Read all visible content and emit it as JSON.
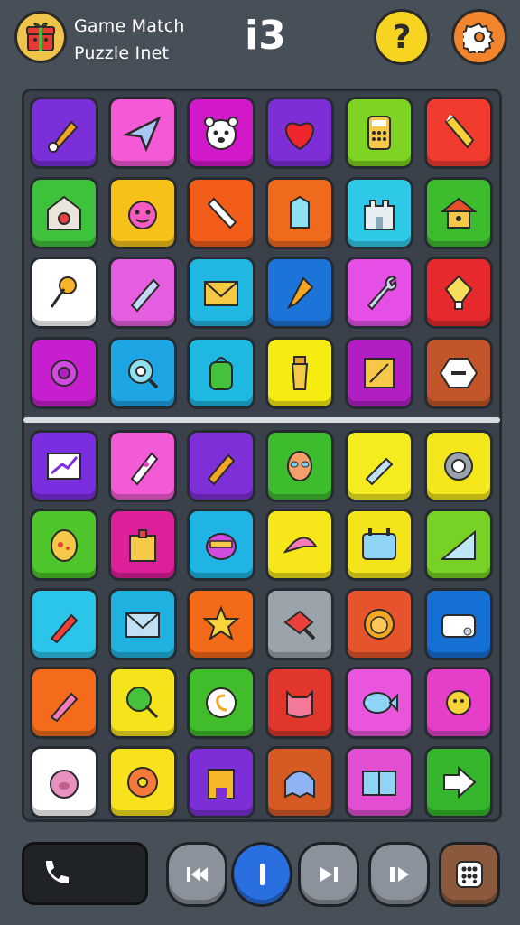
{
  "header": {
    "title_line1": "Game Match",
    "title_line2": "Puzzle Inet",
    "score": "i3",
    "help_label": "?",
    "icons": {
      "app": "gift-box-icon",
      "help": "question-icon",
      "settings": "gear-icon"
    }
  },
  "board": {
    "rows": [
      [
        {
          "color": "#7a2fd9",
          "icon": "paintbrush"
        },
        {
          "color": "#f45ad6",
          "icon": "paper-plane"
        },
        {
          "color": "#d219c9",
          "icon": "bear-face"
        },
        {
          "color": "#7d2ed6",
          "icon": "heart"
        },
        {
          "color": "#7fd322",
          "icon": "calculator"
        },
        {
          "color": "#f23b2f",
          "icon": "pencil"
        }
      ],
      [
        {
          "color": "#3fc23b",
          "icon": "house-camera"
        },
        {
          "color": "#f6c21a",
          "icon": "pink-monster"
        },
        {
          "color": "#f25e1a",
          "icon": "marker"
        },
        {
          "color": "#f06a1e",
          "icon": "crystal"
        },
        {
          "color": "#2fc9e8",
          "icon": "castle"
        },
        {
          "color": "#3dbd2e",
          "icon": "birdhouse"
        }
      ],
      [
        {
          "color": "#ffffff",
          "icon": "pushpin"
        },
        {
          "color": "#e65ee0",
          "icon": "crayon"
        },
        {
          "color": "#21b7e3",
          "icon": "envelope"
        },
        {
          "color": "#1c73d8",
          "icon": "dropper"
        },
        {
          "color": "#e54fe6",
          "icon": "wrench"
        },
        {
          "color": "#e6292c",
          "icon": "lightbulb"
        }
      ],
      [
        {
          "color": "#c71fd0",
          "icon": "gear"
        },
        {
          "color": "#1ea5e3",
          "icon": "magnifier"
        },
        {
          "color": "#1fb8e0",
          "icon": "backpack"
        },
        {
          "color": "#f7ec12",
          "icon": "cup"
        },
        {
          "color": "#b11ec2",
          "icon": "map"
        },
        {
          "color": "#c2562a",
          "icon": "hexagon"
        }
      ]
    ],
    "rows_lower": [
      [
        {
          "color": "#7b2ee0",
          "icon": "chart"
        },
        {
          "color": "#f25ad6",
          "icon": "rocket"
        },
        {
          "color": "#7e2fd8",
          "icon": "pencil-orange"
        },
        {
          "color": "#3dbc2d",
          "icon": "alien"
        },
        {
          "color": "#f4ec1e",
          "icon": "syringe"
        },
        {
          "color": "#f3e61b",
          "icon": "robot-gear"
        }
      ],
      [
        {
          "color": "#4ec52a",
          "icon": "egg"
        },
        {
          "color": "#de1f9a",
          "icon": "bag"
        },
        {
          "color": "#1fb4e3",
          "icon": "monster"
        },
        {
          "color": "#f7e71a",
          "icon": "shark-fin"
        },
        {
          "color": "#f4e41a",
          "icon": "calendar"
        },
        {
          "color": "#78d125",
          "icon": "triangle"
        }
      ],
      [
        {
          "color": "#2cc5ea",
          "icon": "pen-red"
        },
        {
          "color": "#1fb2df",
          "icon": "mail"
        },
        {
          "color": "#f36a18",
          "icon": "star-face"
        },
        {
          "color": "#9ba3ab",
          "icon": "magnify-red"
        },
        {
          "color": "#e5542c",
          "icon": "lion"
        },
        {
          "color": "#1570d6",
          "icon": "radio"
        }
      ],
      [
        {
          "color": "#f46b1c",
          "icon": "pencil-pink"
        },
        {
          "color": "#f5e31b",
          "icon": "lollipop"
        },
        {
          "color": "#41bd2b",
          "icon": "coin"
        },
        {
          "color": "#e0362b",
          "icon": "cat"
        },
        {
          "color": "#e956dd",
          "icon": "fish"
        },
        {
          "color": "#e63ec9",
          "icon": "sun-monster"
        }
      ],
      [
        {
          "color": "#ffffff",
          "icon": "pig"
        },
        {
          "color": "#f8e21d",
          "icon": "donut"
        },
        {
          "color": "#7c2fd7",
          "icon": "tower-face"
        },
        {
          "color": "#d55a24",
          "icon": "ghost"
        },
        {
          "color": "#e24fd2",
          "icon": "book"
        },
        {
          "color": "#35b62c",
          "icon": "arrow-right"
        }
      ]
    ]
  },
  "controls": {
    "call_icon": "phone-icon",
    "buttons": [
      {
        "name": "rewind-button",
        "icon": "rewind-icon"
      },
      {
        "name": "pause-button",
        "icon": "pipe-icon"
      },
      {
        "name": "next-button",
        "icon": "skip-forward-icon"
      },
      {
        "name": "play-pause-button",
        "icon": "pause-play-icon"
      },
      {
        "name": "grid-menu-button",
        "icon": "dice-grid-icon"
      }
    ]
  }
}
